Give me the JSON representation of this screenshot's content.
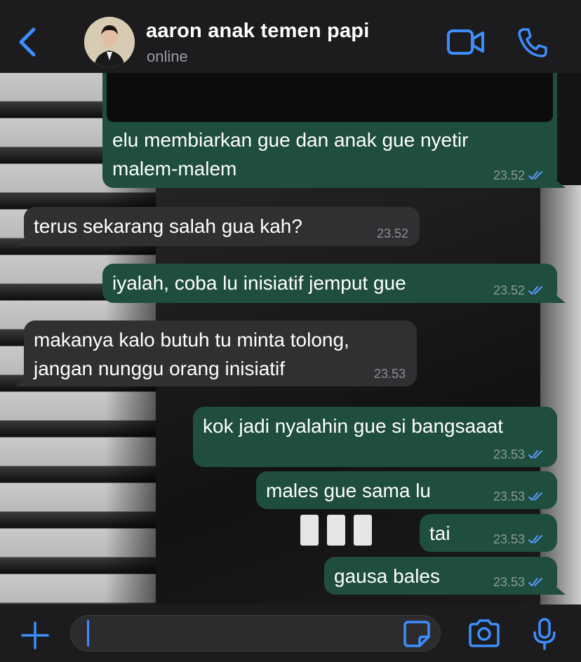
{
  "header": {
    "contact_name": "aaron anak temen papi",
    "status": "online",
    "icons": [
      "chevron-left-icon",
      "video-camera-icon",
      "phone-icon"
    ]
  },
  "messages": [
    {
      "direction": "outgoing",
      "lines": [
        "elu membiarkan gue dan anak gue nyetir",
        "malem-malem"
      ],
      "time": "23.52",
      "read": true
    },
    {
      "direction": "incoming",
      "lines": [
        "terus sekarang salah gua kah?"
      ],
      "time": "23.52"
    },
    {
      "direction": "outgoing",
      "lines": [
        "iyalah, coba lu inisiatif jemput gue"
      ],
      "time": "23.52",
      "read": true
    },
    {
      "direction": "incoming",
      "lines": [
        "makanya kalo butuh tu minta tolong,",
        "jangan nunggu orang inisiatif"
      ],
      "time": "23.53"
    },
    {
      "direction": "outgoing",
      "lines": [
        "kok jadi nyalahin gue si bangsaaat"
      ],
      "time": "23.53",
      "read": true
    },
    {
      "direction": "outgoing",
      "lines": [
        "males gue sama lu"
      ],
      "time": "23.53",
      "read": true
    },
    {
      "direction": "outgoing",
      "lines": [
        "tai"
      ],
      "time": "23.53",
      "read": true
    },
    {
      "direction": "outgoing",
      "lines": [
        "gausa bales"
      ],
      "time": "23.53",
      "read": true
    }
  ],
  "input": {
    "value": "",
    "placeholder": "",
    "icons": [
      "plus-icon",
      "sticker-icon",
      "camera-icon",
      "microphone-icon"
    ]
  },
  "colors": {
    "accent": "#3d8eff",
    "outgoing_bubble": "#1f4d3f",
    "incoming_bubble": "#303033",
    "read_ticks": "#5b9bff",
    "bar_background": "#1c1c1e"
  }
}
